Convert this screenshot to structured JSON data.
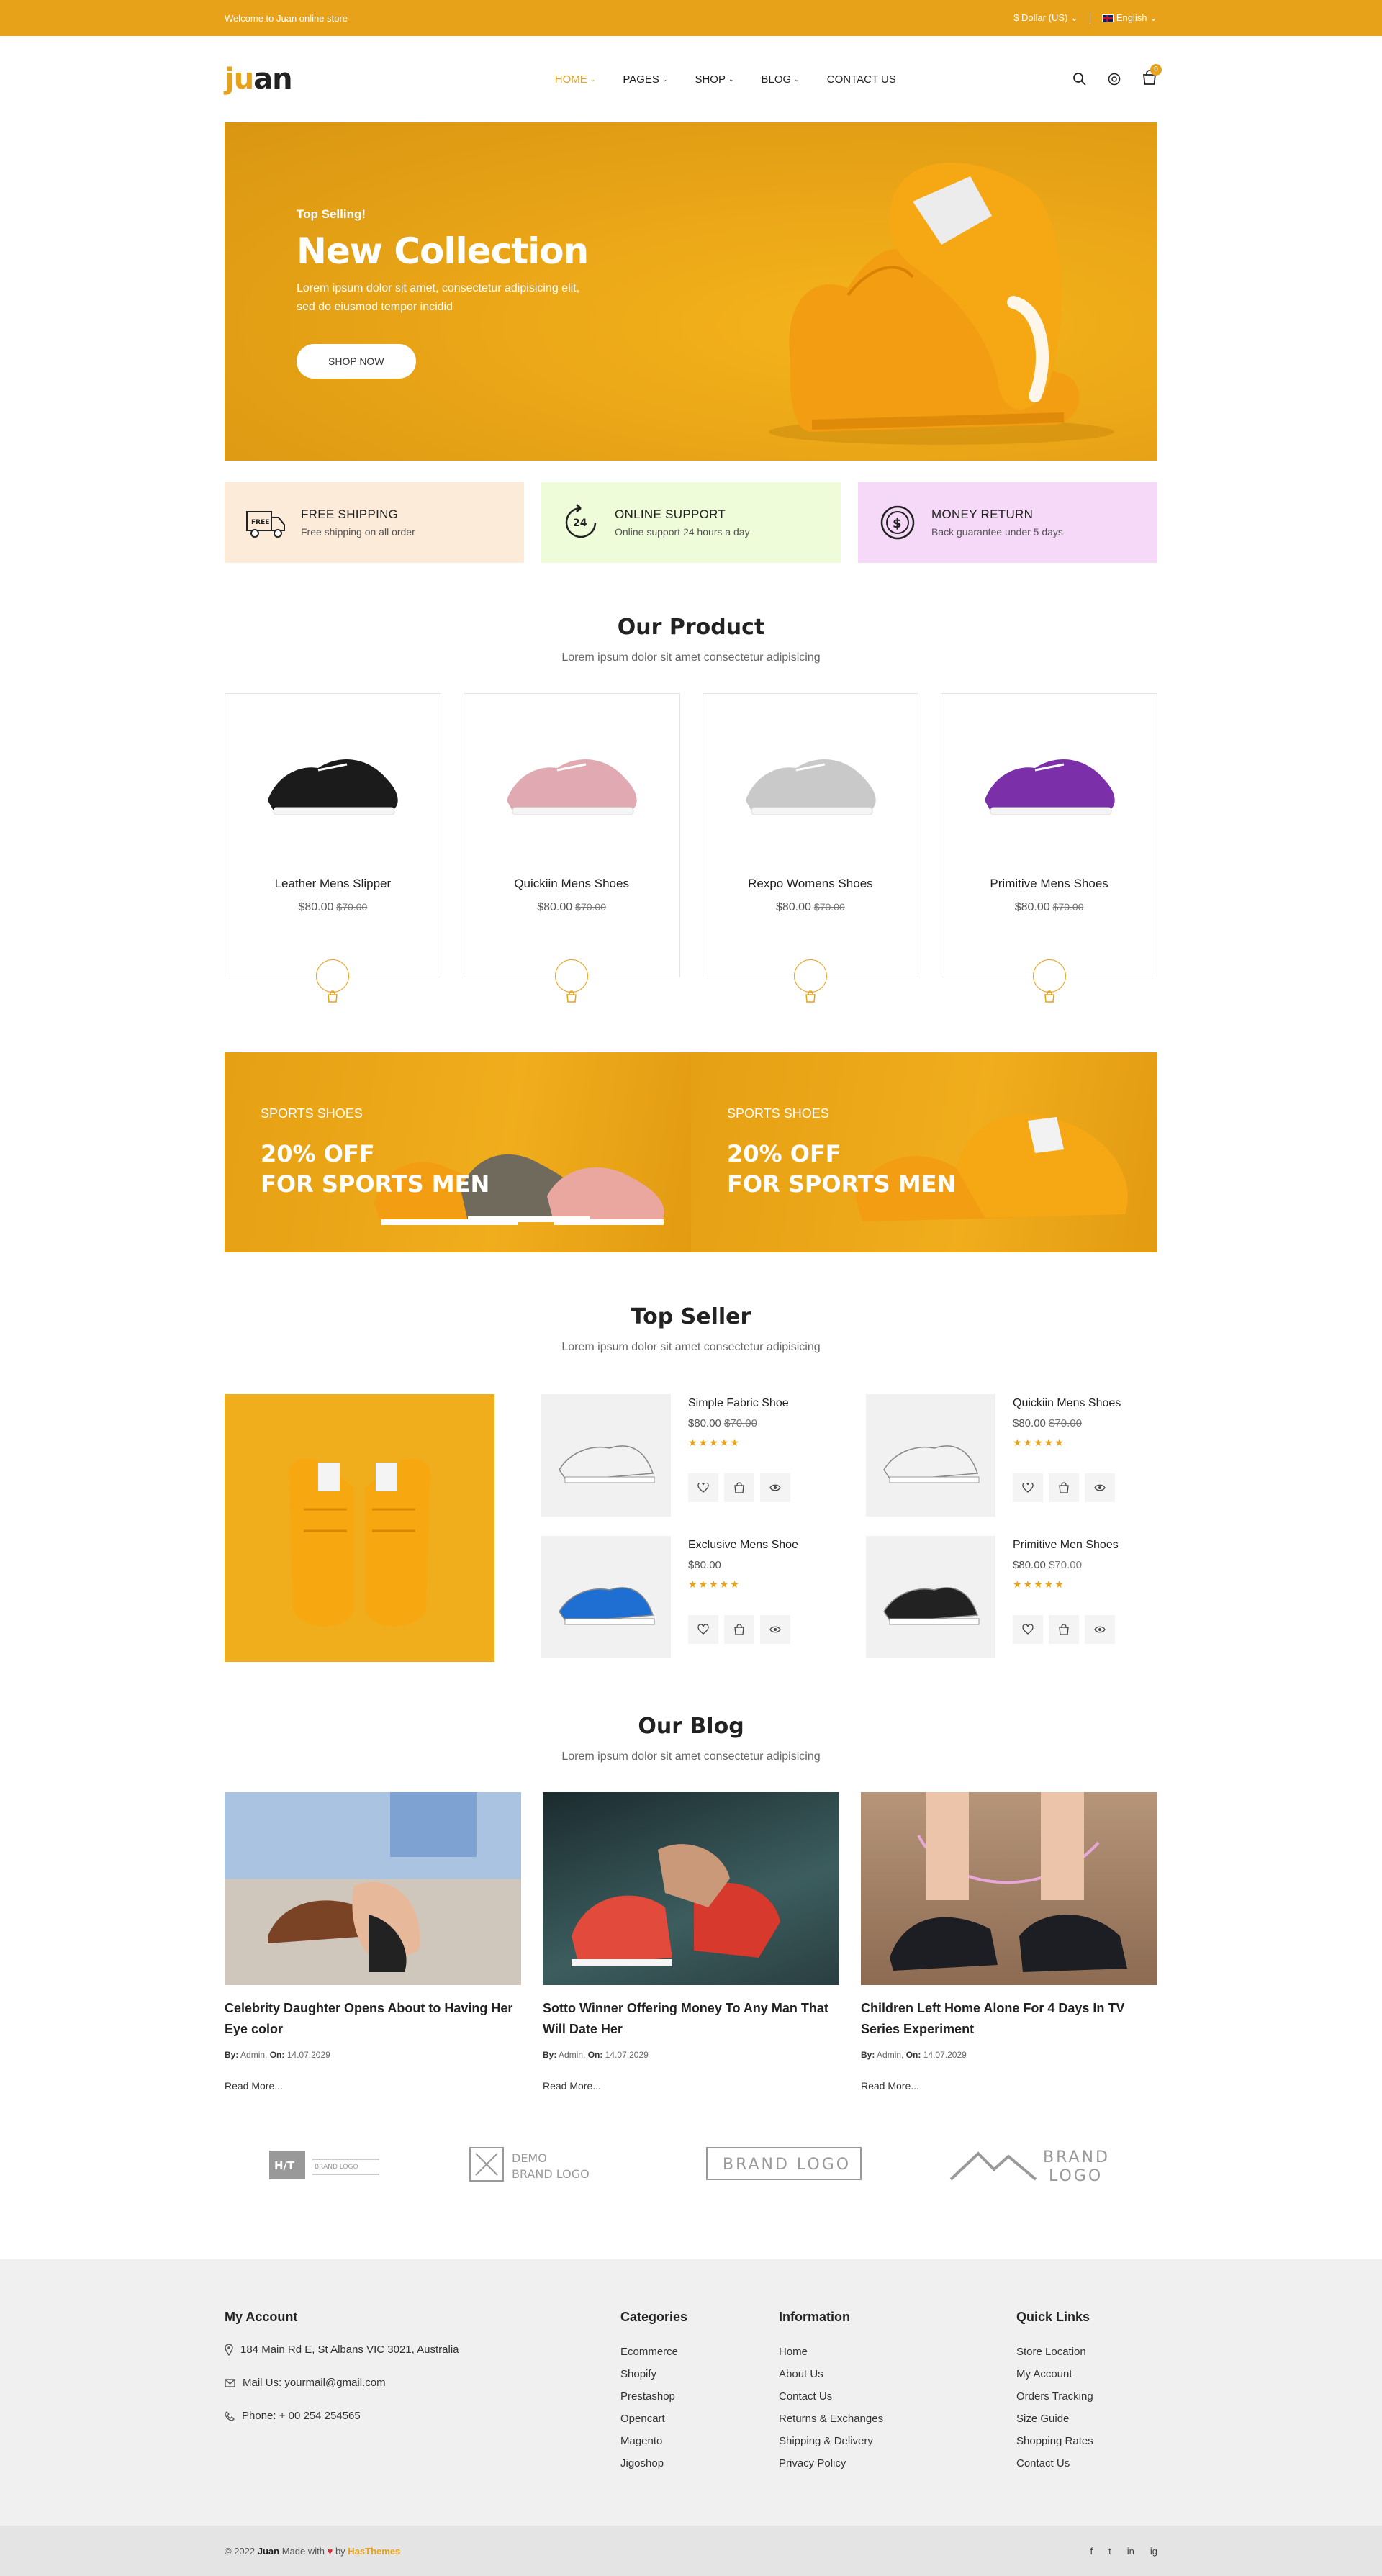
{
  "topbar": {
    "welcome": "Welcome to Juan online store",
    "currency": "$ Dollar (US) ⌄",
    "language": "English ⌄"
  },
  "header": {
    "logo_accent": "ju",
    "logo_rest": "an",
    "cart_count": "0",
    "nav": [
      {
        "label": "HOME",
        "dropdown": true,
        "active": true
      },
      {
        "label": "PAGES",
        "dropdown": true
      },
      {
        "label": "SHOP",
        "dropdown": true
      },
      {
        "label": "BLOG",
        "dropdown": true
      },
      {
        "label": "CONTACT US",
        "dropdown": false
      }
    ]
  },
  "hero": {
    "subtitle": "Top Selling!",
    "title": "New Collection",
    "text": "Lorem ipsum dolor sit amet, consectetur adipisicing elit, sed do eiusmod tempor incidid",
    "button": "SHOP NOW"
  },
  "features": [
    {
      "title": "FREE SHIPPING",
      "desc": "Free shipping on all order",
      "icon": "truck-icon",
      "bg": "#fcebd9"
    },
    {
      "title": "ONLINE SUPPORT",
      "desc": "Online support 24 hours a day",
      "icon": "support-24-icon",
      "bg": "#eefcd9"
    },
    {
      "title": "MONEY RETURN",
      "desc": "Back guarantee under 5 days",
      "icon": "money-return-icon",
      "bg": "#f6d9f8"
    }
  ],
  "our_product": {
    "title": "Our Product",
    "subtitle": "Lorem ipsum dolor sit amet consectetur adipisicing",
    "items": [
      {
        "name": "Leather Mens Slipper",
        "price": "$80.00",
        "old_price": "$70.00",
        "color": "#1b1b1b"
      },
      {
        "name": "Quickiin Mens Shoes",
        "price": "$80.00",
        "old_price": "$70.00",
        "color": "#e1aab3"
      },
      {
        "name": "Rexpo Womens Shoes",
        "price": "$80.00",
        "old_price": "$70.00",
        "color": "#c9c9c9"
      },
      {
        "name": "Primitive Mens Shoes",
        "price": "$80.00",
        "old_price": "$70.00",
        "color": "#7b2fa8"
      }
    ]
  },
  "banners": [
    {
      "label": "SPORTS SHOES",
      "line1": "20% OFF",
      "line2": "FOR SPORTS MEN"
    },
    {
      "label": "SPORTS SHOES",
      "line1": "20% OFF",
      "line2": "FOR SPORTS MEN"
    }
  ],
  "top_seller": {
    "title": "Top Seller",
    "subtitle": "Lorem ipsum dolor sit amet consectetur adipisicing",
    "items": [
      {
        "name": "Simple Fabric Shoe",
        "price": "$80.00",
        "old_price": "$70.00",
        "stars": "★★★★★"
      },
      {
        "name": "Quickiin Mens Shoes",
        "price": "$80.00",
        "old_price": "$70.00",
        "stars": "★★★★★"
      },
      {
        "name": "Exclusive Mens Shoe",
        "price": "$80.00",
        "old_price": "",
        "stars": "★★★★★"
      },
      {
        "name": "Primitive Men Shoes",
        "price": "$80.00",
        "old_price": "$70.00",
        "stars": "★★★★★"
      }
    ]
  },
  "blog": {
    "title": "Our Blog",
    "subtitle": "Lorem ipsum dolor sit amet consectetur adipisicing",
    "posts": [
      {
        "title": "Celebrity Daughter Opens About to Having Her Eye color",
        "by_label": "By:",
        "author": "Admin,",
        "on_label": "On:",
        "date": "14.07.2029",
        "more": "Read More..."
      },
      {
        "title": "Sotto Winner Offering Money To Any Man That Will Date Her",
        "by_label": "By:",
        "author": "Admin,",
        "on_label": "On:",
        "date": "14.07.2029",
        "more": "Read More..."
      },
      {
        "title": "Children Left Home Alone For 4 Days In TV Series Experiment",
        "by_label": "By:",
        "author": "Admin,",
        "on_label": "On:",
        "date": "14.07.2029",
        "more": "Read More..."
      }
    ]
  },
  "brands": [
    "H/T BRAND LOGO",
    "DEMO BRAND LOGO",
    "BRAND LOGO",
    "BRAND LOGO"
  ],
  "footer": {
    "account": {
      "title": "My Account",
      "address": "184 Main Rd E, St Albans VIC 3021, Australia",
      "email": "Mail Us: yourmail@gmail.com",
      "phone": "Phone: + 00 254 254565"
    },
    "categories": {
      "title": "Categories",
      "links": [
        "Ecommerce",
        "Shopify",
        "Prestashop",
        "Opencart",
        "Magento",
        "Jigoshop"
      ]
    },
    "information": {
      "title": "Information",
      "links": [
        "Home",
        "About Us",
        "Contact Us",
        "Returns & Exchanges",
        "Shipping & Delivery",
        "Privacy Policy"
      ]
    },
    "quick": {
      "title": "Quick Links",
      "links": [
        "Store Location",
        "My Account",
        "Orders Tracking",
        "Size Guide",
        "Shopping Rates",
        "Contact Us"
      ]
    }
  },
  "copyright": {
    "pre": "© 2022",
    "brand": "Juan",
    "made": "Made with",
    "by": "by",
    "company": "HasThemes"
  },
  "social": [
    "f",
    "t",
    "in",
    "ig"
  ]
}
